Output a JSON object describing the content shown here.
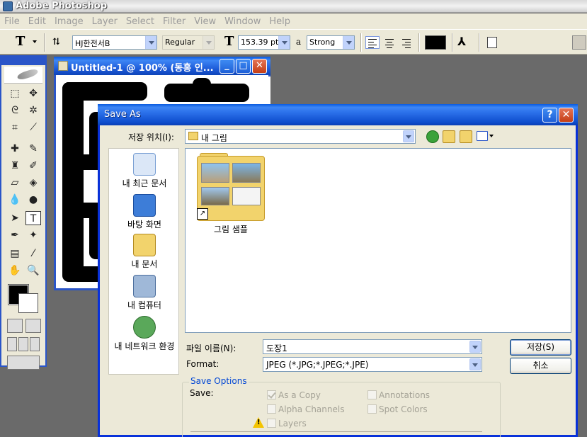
{
  "app": {
    "title": "Adobe Photoshop"
  },
  "menu": [
    "File",
    "Edit",
    "Image",
    "Layer",
    "Select",
    "Filter",
    "View",
    "Window",
    "Help"
  ],
  "options_bar": {
    "tool_glyph": "T",
    "font_family": "HJ한전서B",
    "font_style": "Regular",
    "font_size": "153.39 pt",
    "aa_glyph": "a",
    "antialias": "Strong",
    "text_color": "#000000"
  },
  "toolbox": {
    "fg_color": "#000000",
    "bg_color": "#ffffff"
  },
  "document": {
    "title": "Untitled-1 @ 100% (동홍 인..."
  },
  "dialog": {
    "title": "Save As",
    "help_glyph": "?",
    "close_glyph": "✕",
    "save_in_label": "저장 위치(I):",
    "save_in_value": "내 그림",
    "places": [
      {
        "label": "내 최근 문서"
      },
      {
        "label": "바탕 화면"
      },
      {
        "label": "내 문서"
      },
      {
        "label": "내 컴퓨터"
      },
      {
        "label": "내 네트워크 환경"
      }
    ],
    "files": [
      {
        "name": "그림 샘플"
      }
    ],
    "filename_label": "파일 이름(N):",
    "filename_value": "도장1",
    "format_label": "Format:",
    "format_value": "JPEG (*.JPG;*.JPEG;*.JPE)",
    "save_button": "저장(S)",
    "cancel_button": "취소",
    "save_options": {
      "legend": "Save Options",
      "save_label": "Save:",
      "as_a_copy": "As a Copy",
      "annotations": "Annotations",
      "alpha_channels": "Alpha Channels",
      "spot_colors": "Spot Colors",
      "layers": "Layers"
    }
  }
}
